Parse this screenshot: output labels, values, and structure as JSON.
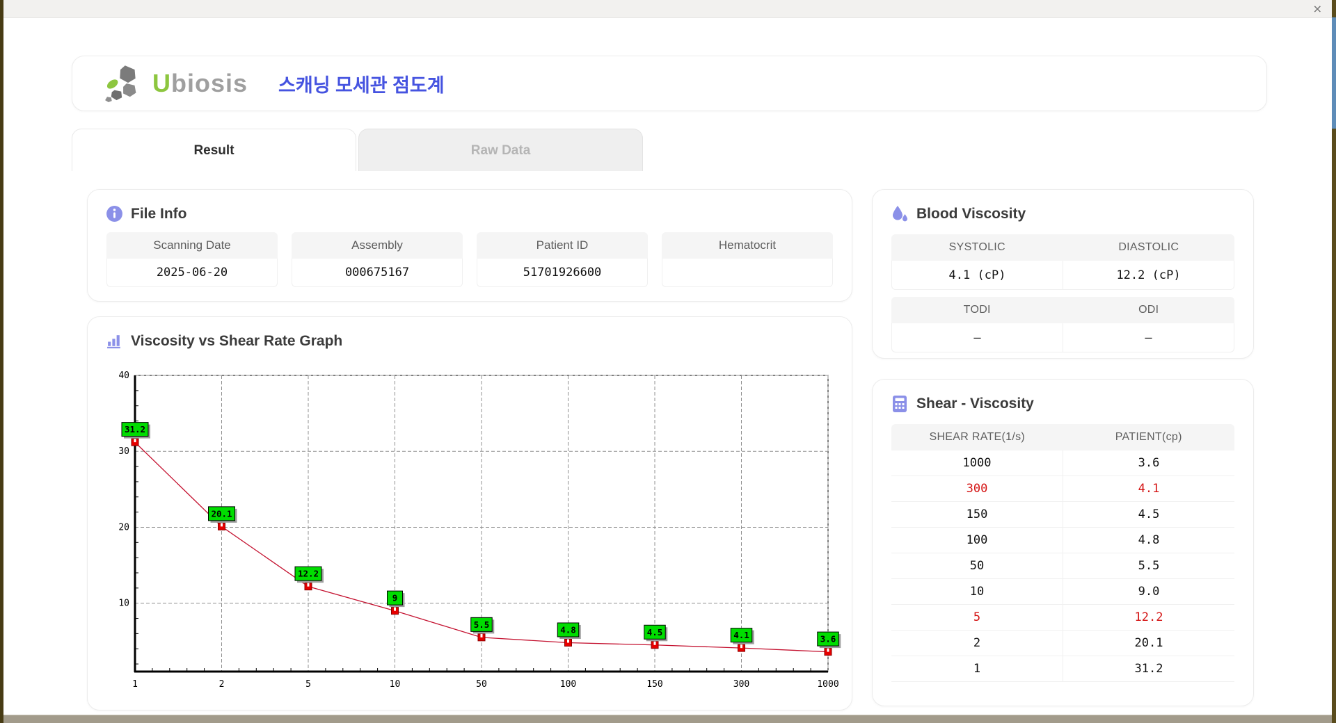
{
  "window": {
    "close": "×"
  },
  "brand": {
    "green": "U",
    "gray": "biosis",
    "subtitle": "스캐닝 모세관 점도계"
  },
  "tabs": {
    "result": "Result",
    "raw": "Raw Data"
  },
  "file_info": {
    "title": "File Info",
    "fields": [
      {
        "label": "Scanning Date",
        "value": "2025-06-20"
      },
      {
        "label": "Assembly",
        "value": "000675167"
      },
      {
        "label": "Patient ID",
        "value": "51701926600"
      },
      {
        "label": "Hematocrit",
        "value": ""
      }
    ]
  },
  "blood_viscosity": {
    "title": "Blood Viscosity",
    "groups": [
      {
        "h1": "SYSTOLIC",
        "h2": "DIASTOLIC",
        "v1": "4.1 (cP)",
        "v2": "12.2 (cP)"
      },
      {
        "h1": "TODI",
        "h2": "ODI",
        "v1": "–",
        "v2": "–"
      }
    ]
  },
  "shear_viscosity": {
    "title": "Shear - Viscosity",
    "col1": "SHEAR RATE(1/s)",
    "col2": "PATIENT(cp)",
    "rows": [
      {
        "shear": "1000",
        "patient": "3.6",
        "highlight": false
      },
      {
        "shear": "300",
        "patient": "4.1",
        "highlight": true
      },
      {
        "shear": "150",
        "patient": "4.5",
        "highlight": false
      },
      {
        "shear": "100",
        "patient": "4.8",
        "highlight": false
      },
      {
        "shear": "50",
        "patient": "5.5",
        "highlight": false
      },
      {
        "shear": "10",
        "patient": "9.0",
        "highlight": false
      },
      {
        "shear": "5",
        "patient": "12.2",
        "highlight": true
      },
      {
        "shear": "2",
        "patient": "20.1",
        "highlight": false
      },
      {
        "shear": "1",
        "patient": "31.2",
        "highlight": false
      }
    ]
  },
  "graph": {
    "title": "Viscosity vs Shear Rate Graph"
  },
  "chart_data": {
    "type": "line",
    "title": "Viscosity vs Shear Rate Graph",
    "x_categories": [
      "1",
      "2",
      "5",
      "10",
      "50",
      "100",
      "150",
      "300",
      "1000"
    ],
    "values": [
      31.2,
      20.1,
      12.2,
      9,
      5.5,
      4.8,
      4.5,
      4.1,
      3.6
    ],
    "point_labels": [
      "31.2",
      "20.1",
      "12.2",
      "9",
      "5.5",
      "4.8",
      "4.5",
      "4.1",
      "3.6"
    ],
    "xlabel": "",
    "ylabel": "",
    "y_ticks": [
      10,
      20,
      30,
      40
    ],
    "ylim": [
      1,
      40
    ],
    "grid": "dashed",
    "legend": "none",
    "line_color": "#c41230",
    "marker_color": "#e60000",
    "label_bg": "#00dd00"
  },
  "colors": {
    "accent_purple": "#8b90e8",
    "brand_green": "#8dc63f",
    "subtitle_blue": "#4553e0",
    "highlight_red": "#d41414"
  }
}
